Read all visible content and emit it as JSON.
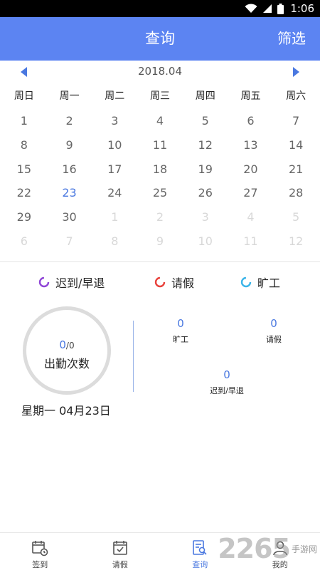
{
  "status_bar": {
    "time": "1:06"
  },
  "header": {
    "title": "查询",
    "filter_label": "筛选"
  },
  "calendar": {
    "month_label": "2018.04",
    "weekdays": [
      "周日",
      "周一",
      "周二",
      "周三",
      "周四",
      "周五",
      "周六"
    ],
    "days": [
      {
        "d": "1"
      },
      {
        "d": "2"
      },
      {
        "d": "3"
      },
      {
        "d": "4"
      },
      {
        "d": "5"
      },
      {
        "d": "6"
      },
      {
        "d": "7"
      },
      {
        "d": "8"
      },
      {
        "d": "9"
      },
      {
        "d": "10"
      },
      {
        "d": "11"
      },
      {
        "d": "12"
      },
      {
        "d": "13"
      },
      {
        "d": "14"
      },
      {
        "d": "15"
      },
      {
        "d": "16"
      },
      {
        "d": "17"
      },
      {
        "d": "18"
      },
      {
        "d": "19"
      },
      {
        "d": "20"
      },
      {
        "d": "21"
      },
      {
        "d": "22"
      },
      {
        "d": "23",
        "today": true
      },
      {
        "d": "24"
      },
      {
        "d": "25"
      },
      {
        "d": "26"
      },
      {
        "d": "27"
      },
      {
        "d": "28"
      },
      {
        "d": "29"
      },
      {
        "d": "30"
      },
      {
        "d": "1",
        "muted": true
      },
      {
        "d": "2",
        "muted": true
      },
      {
        "d": "3",
        "muted": true
      },
      {
        "d": "4",
        "muted": true
      },
      {
        "d": "5",
        "muted": true
      },
      {
        "d": "6",
        "muted": true
      },
      {
        "d": "7",
        "muted": true
      },
      {
        "d": "8",
        "muted": true
      },
      {
        "d": "9",
        "muted": true
      },
      {
        "d": "10",
        "muted": true
      },
      {
        "d": "11",
        "muted": true
      },
      {
        "d": "12",
        "muted": true
      }
    ]
  },
  "legend": {
    "late_early": {
      "label": "迟到/早退",
      "color": "#8e44d6"
    },
    "leave": {
      "label": "请假",
      "color": "#e8403a"
    },
    "absent": {
      "label": "旷工",
      "color": "#3ab4e8"
    }
  },
  "summary": {
    "attended": "0",
    "total": "/0",
    "ring_label": "出勤次数",
    "date": "星期一  04月23日",
    "stats": {
      "absent": {
        "value": "0",
        "label": "旷工"
      },
      "leave": {
        "value": "0",
        "label": "请假"
      },
      "late_early": {
        "value": "0",
        "label": "迟到/早退"
      }
    }
  },
  "tabs": [
    {
      "label": "签到",
      "icon": "checkin-calendar-icon"
    },
    {
      "label": "请假",
      "icon": "leave-calendar-icon"
    },
    {
      "label": "查询",
      "icon": "query-document-icon",
      "active": true
    },
    {
      "label": "我的",
      "icon": "profile-icon"
    }
  ],
  "watermark": {
    "big": "2265",
    "small": "手游网"
  },
  "colors": {
    "accent": "#5c84f2",
    "link": "#4a78e0"
  }
}
